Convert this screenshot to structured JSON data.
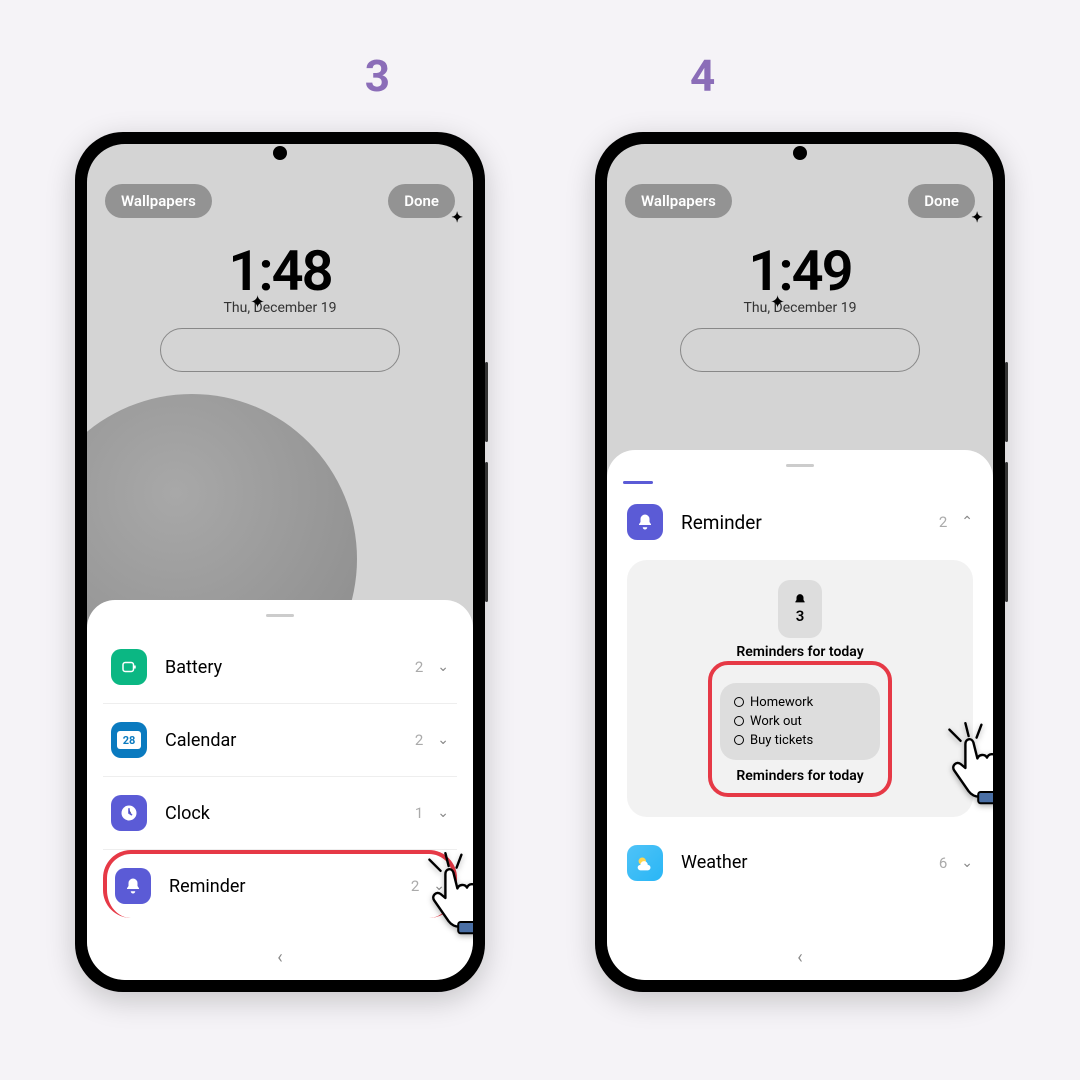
{
  "steps": {
    "s3": "3",
    "s4": "4"
  },
  "left": {
    "wallpapers": "Wallpapers",
    "done": "Done",
    "time": "1:48",
    "date": "Thu, December 19",
    "items": [
      {
        "name": "Battery",
        "count": "2"
      },
      {
        "name": "Calendar",
        "count": "2",
        "day": "28"
      },
      {
        "name": "Clock",
        "count": "1"
      },
      {
        "name": "Reminder",
        "count": "2"
      }
    ]
  },
  "right": {
    "wallpapers": "Wallpapers",
    "done": "Done",
    "time": "1:49",
    "date": "Thu, December 19",
    "reminder": {
      "name": "Reminder",
      "count": "2",
      "badge": "3",
      "title": "Reminders for today",
      "tasks": [
        "Homework",
        "Work out",
        "Buy tickets"
      ],
      "subtitle": "Reminders for today"
    },
    "weather": {
      "name": "Weather",
      "count": "6"
    }
  }
}
